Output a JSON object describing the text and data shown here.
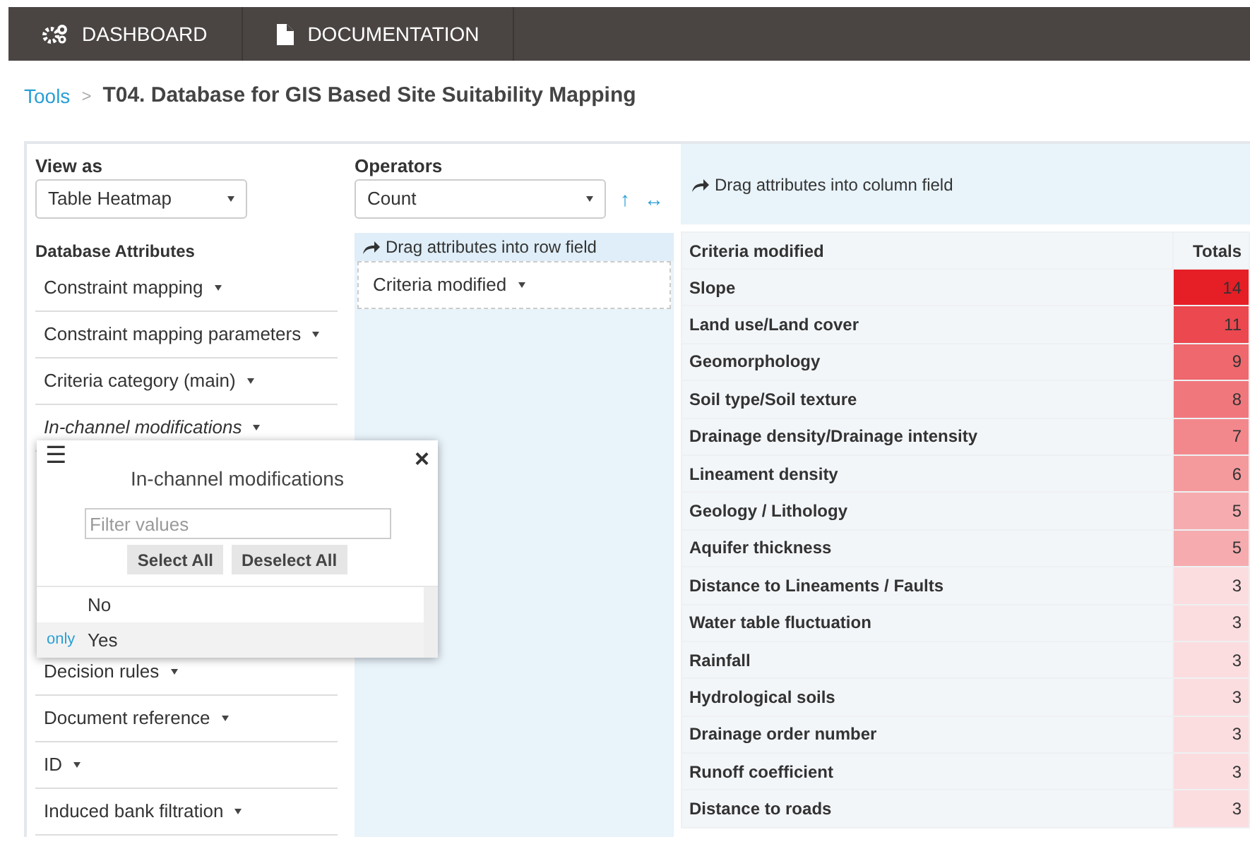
{
  "nav": [
    {
      "label": "DASHBOARD",
      "kind": "gears"
    },
    {
      "label": "DOCUMENTATION",
      "kind": "file"
    }
  ],
  "breadcrumb": {
    "link": "Tools",
    "separator": ">",
    "title": "T04. Database for GIS Based Site Suitability Mapping"
  },
  "view_as": {
    "label": "View as",
    "value": "Table Heatmap"
  },
  "operators": {
    "label": "Operators",
    "value": "Count",
    "sort_icon": "↑",
    "swap_icon": "↔"
  },
  "attributes": {
    "title": "Database Attributes",
    "items": [
      {
        "label": "Constraint mapping",
        "filtered": false
      },
      {
        "label": "Constraint mapping parameters",
        "filtered": false
      },
      {
        "label": "Criteria category (main)",
        "filtered": false
      },
      {
        "label": "In-channel modifications",
        "filtered": true
      }
    ],
    "items_below": [
      {
        "label": "Decision rules",
        "filtered": false
      },
      {
        "label": "Document reference",
        "filtered": false
      },
      {
        "label": "ID",
        "filtered": false
      },
      {
        "label": "Induced bank filtration",
        "filtered": false
      }
    ]
  },
  "row_field": {
    "hint": "Drag attributes into row field",
    "items": [
      {
        "label": "Criteria modified"
      }
    ]
  },
  "column_field": {
    "hint": "Drag attributes into column field"
  },
  "filter_popup": {
    "menu_icon": "☰",
    "title": "In-channel modifications",
    "close": "×",
    "placeholder": "Filter values",
    "buttons": [
      "Select All",
      "Deselect All"
    ],
    "values": [
      {
        "label": "No",
        "highlighted": false
      },
      {
        "label": "Yes",
        "highlighted": true,
        "action": "only"
      }
    ]
  },
  "table": {
    "columns": [
      "Criteria modified",
      "Totals"
    ],
    "rows": [
      [
        "Slope",
        "14"
      ],
      [
        "Land use/Land cover",
        "11"
      ],
      [
        "Geomorphology",
        "9"
      ],
      [
        "Soil type/Soil texture",
        "8"
      ],
      [
        "Drainage density/Drainage intensity",
        "7"
      ],
      [
        "Lineament density",
        "6"
      ],
      [
        "Geology / Lithology",
        "5"
      ],
      [
        "Aquifer thickness",
        "5"
      ],
      [
        "Distance to Lineaments / Faults",
        "3"
      ],
      [
        "Water table fluctuation",
        "3"
      ],
      [
        "Rainfall",
        "3"
      ],
      [
        "Hydrological soils",
        "3"
      ],
      [
        "Drainage order number",
        "3"
      ],
      [
        "Runoff coefficient",
        "3"
      ],
      [
        "Distance to roads",
        "3"
      ]
    ]
  }
}
